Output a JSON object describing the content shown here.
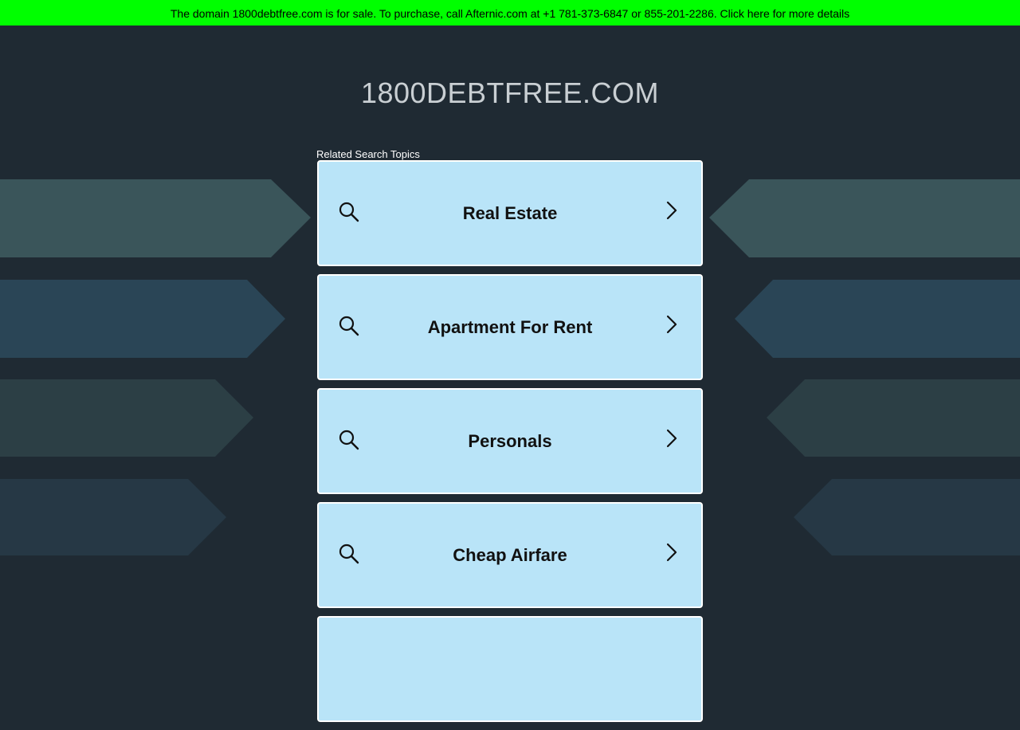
{
  "banner": {
    "text": "The domain 1800debtfree.com is for sale. To purchase, call Afternic.com at +1 781-373-6847 or 855-201-2286. Click here for more details",
    "color": "#00ff00"
  },
  "site": {
    "title": "1800DEBTFREE.COM"
  },
  "related": {
    "label": "Related Search Topics",
    "items": [
      {
        "label": "Real Estate",
        "icon": "search-icon"
      },
      {
        "label": "Apartment For Rent",
        "icon": "search-icon"
      },
      {
        "label": "Personals",
        "icon": "search-icon"
      },
      {
        "label": "Cheap Airfare",
        "icon": "search-icon"
      },
      {
        "label": "",
        "icon": "search-icon"
      }
    ]
  },
  "colors": {
    "background": "#1f2a33",
    "card": "#b9e4f8",
    "card_border": "#ffffff"
  }
}
